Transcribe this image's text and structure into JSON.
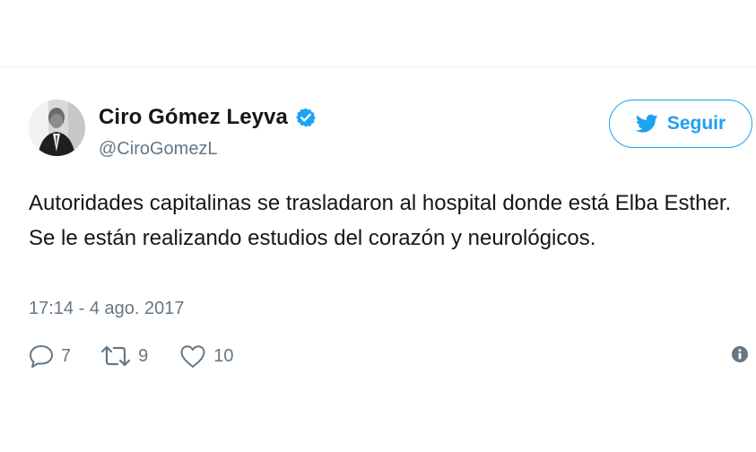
{
  "author": {
    "display_name": "Ciro Gómez Leyva",
    "handle": "@CiroGomezL",
    "verified": true,
    "avatar_icon": "user-avatar"
  },
  "follow_button": {
    "label": "Seguir",
    "icon": "twitter-bird-icon",
    "color": "#1da1f2"
  },
  "tweet": {
    "text": "Autoridades capitalinas se trasladaron al hospital donde está Elba Esther. Se le están realizando estudios del corazón y neurológicos.",
    "timestamp": "17:14 - 4 ago. 2017"
  },
  "actions": {
    "reply_count": "7",
    "retweet_count": "9",
    "like_count": "10"
  },
  "colors": {
    "brand": "#1da1f2",
    "text": "#14171a",
    "secondary_text": "#657786",
    "divider": "#e6ecf0"
  }
}
